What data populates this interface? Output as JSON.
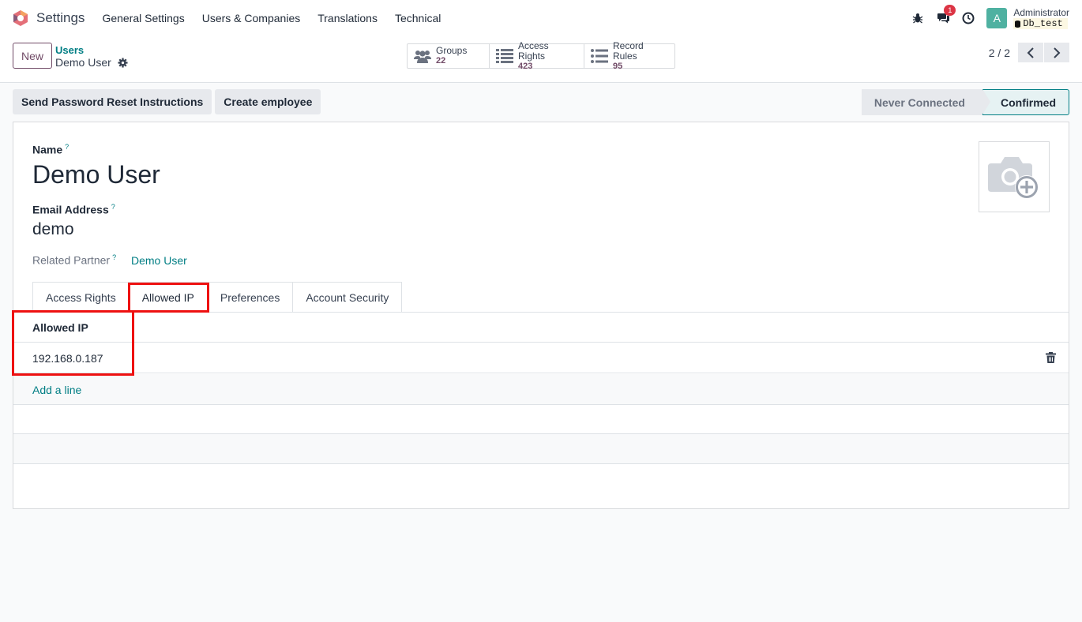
{
  "navbar": {
    "app_name": "Settings",
    "menu": [
      "General Settings",
      "Users & Companies",
      "Translations",
      "Technical"
    ],
    "messages_badge": "1",
    "avatar_letter": "A",
    "user_name": "Administrator",
    "db_name": "Db_test"
  },
  "control": {
    "new_label": "New",
    "breadcrumb": "Users",
    "record_title": "Demo User",
    "smart_buttons": [
      {
        "label": "Groups",
        "value": "22",
        "icon": "users-icon"
      },
      {
        "label": "Access Rights",
        "value": "423",
        "icon": "list-icon"
      },
      {
        "label": "Record Rules",
        "value": "95",
        "icon": "list-icon"
      }
    ],
    "pager": "2 / 2"
  },
  "actions": {
    "reset_password": "Send Password Reset Instructions",
    "create_employee": "Create employee"
  },
  "status": {
    "never_connected": "Never Connected",
    "confirmed": "Confirmed"
  },
  "form": {
    "name_label": "Name",
    "name_value": "Demo User",
    "email_label": "Email Address",
    "email_value": "demo",
    "partner_label": "Related Partner",
    "partner_value": "Demo User",
    "help_mark": "?"
  },
  "tabs": [
    "Access Rights",
    "Allowed IP",
    "Preferences",
    "Account Security"
  ],
  "allowed_ip": {
    "column": "Allowed IP",
    "rows": [
      "192.168.0.187"
    ],
    "add_line": "Add a line"
  },
  "colors": {
    "brand": "#714b67",
    "link": "#017e84",
    "highlight": "#ee1111"
  }
}
